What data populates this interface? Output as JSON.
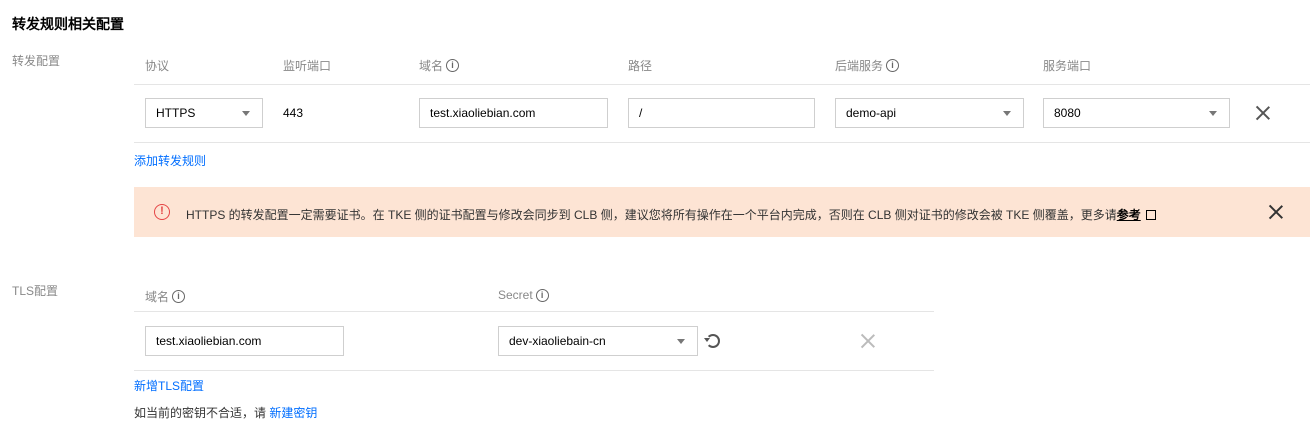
{
  "section": {
    "title": "转发规则相关配置"
  },
  "forward": {
    "label": "转发配置",
    "headers": {
      "protocol": "协议",
      "port": "监听端口",
      "domain": "域名",
      "path": "路径",
      "backend": "后端服务",
      "service_port": "服务端口"
    },
    "row": {
      "protocol": "HTTPS",
      "port": "443",
      "domain": "test.xiaoliebian.com",
      "path": "/",
      "backend": "demo-api",
      "service_port": "8080"
    },
    "add_link": "添加转发规则"
  },
  "alert": {
    "text": "HTTPS 的转发配置一定需要证书。在 TKE 侧的证书配置与修改会同步到 CLB 侧，建议您将所有操作在一个平台内完成，否则在 CLB 侧对证书的修改会被 TKE 侧覆盖，更多请",
    "link": "参考",
    "background": "#fde4d4",
    "icon_color": "#e54545"
  },
  "tls": {
    "label": "TLS配置",
    "headers": {
      "domain": "域名",
      "secret": "Secret"
    },
    "row": {
      "domain": "test.xiaoliebian.com",
      "secret": "dev-xiaoliebain-cn"
    },
    "add_link": "新增TLS配置",
    "hint": "如当前的密钥不合适，请",
    "hint_link": "新建密钥"
  },
  "colors": {
    "link": "#006eff",
    "muted": "#888888"
  }
}
